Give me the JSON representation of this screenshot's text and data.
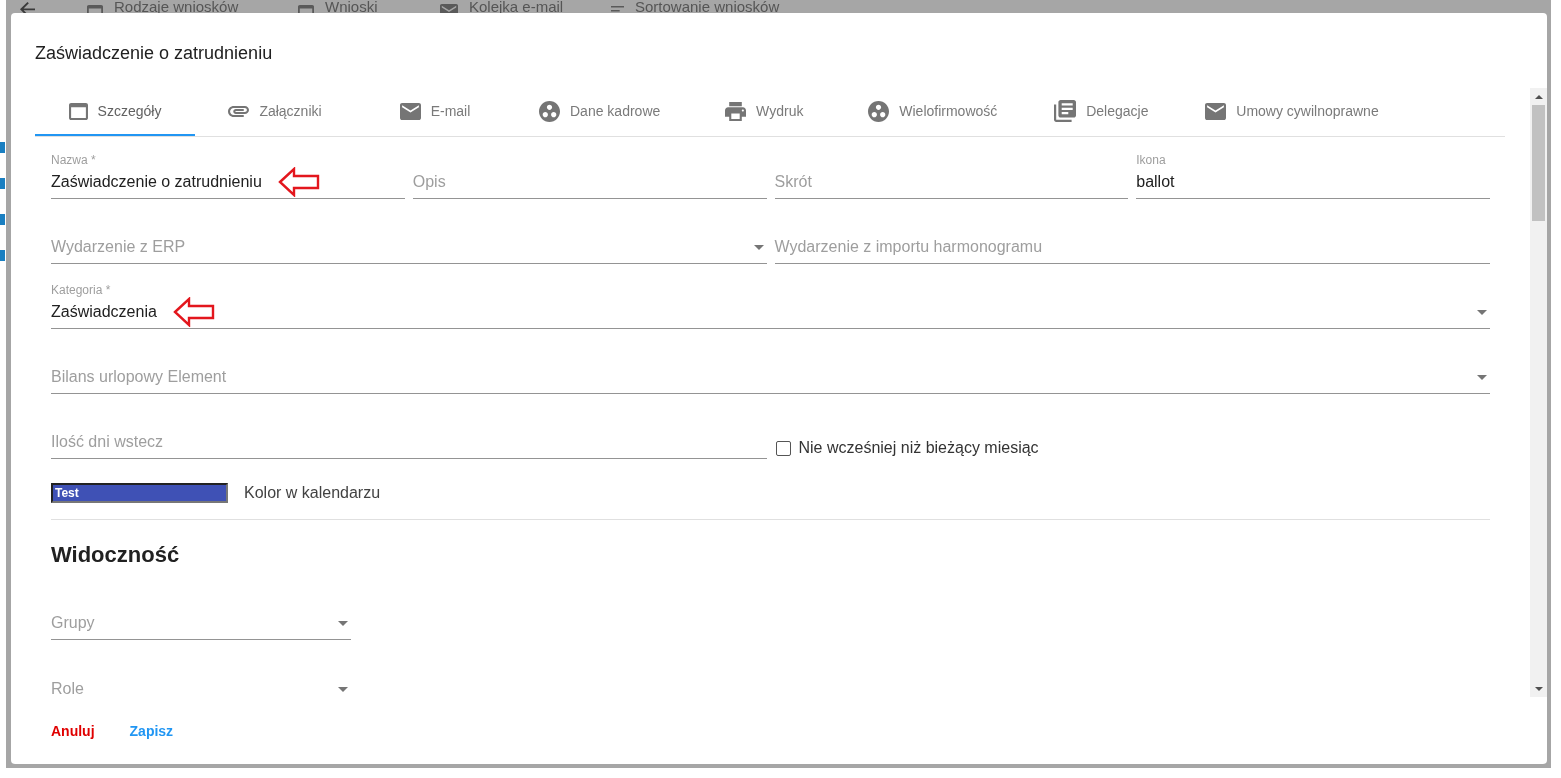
{
  "background_toolbar": [
    {
      "label": "Rodzaje wniosków"
    },
    {
      "label": "Wnioski"
    },
    {
      "label": "Kolejka e-mail"
    },
    {
      "label": "Sortowanie wniosków"
    }
  ],
  "dialog": {
    "title": "Zaświadczenie o zatrudnieniu",
    "tabs": [
      {
        "label": "Szczegóły",
        "selected": true
      },
      {
        "label": "Załączniki",
        "selected": false
      },
      {
        "label": "E-mail",
        "selected": false
      },
      {
        "label": "Dane kadrowe",
        "selected": false
      },
      {
        "label": "Wydruk",
        "selected": false
      },
      {
        "label": "Wielofirmowość",
        "selected": false
      },
      {
        "label": "Delegacje",
        "selected": false
      },
      {
        "label": "Umowy cywilnoprawne",
        "selected": false
      }
    ],
    "form_rows": [
      [
        {
          "kind": "text",
          "label": "Nazwa *",
          "value": "Zaświadczenie o zatrudnieniu",
          "annotated": true
        },
        {
          "kind": "text",
          "placeholder": "Opis",
          "annotated": false
        },
        {
          "kind": "text",
          "placeholder": "Skrót",
          "annotated": false
        },
        {
          "kind": "text",
          "label": "Ikona",
          "value": "ballot",
          "annotated": false
        }
      ],
      [
        {
          "kind": "select",
          "placeholder": "Wydarzenie z ERP",
          "annotated": false
        },
        {
          "kind": "text",
          "placeholder": "Wydarzenie z importu harmonogramu",
          "annotated": false
        }
      ],
      [
        {
          "kind": "select",
          "label": "Kategoria *",
          "value": "Zaświadczenia",
          "annotated": true
        }
      ],
      [
        {
          "kind": "select",
          "placeholder": "Bilans urlopowy Element",
          "annotated": false
        }
      ],
      [
        {
          "kind": "text",
          "placeholder": "Ilość dni wstecz",
          "annotated": false
        },
        {
          "kind": "checkbox",
          "label": "Nie wcześniej niż bieżący miesiąc",
          "checked": false
        }
      ]
    ],
    "color_field": {
      "value": "Test",
      "color": "#3f51b5",
      "label": "Kolor w kalendarzu"
    },
    "visibility": {
      "heading": "Widoczność",
      "fields": [
        {
          "kind": "select",
          "placeholder": "Grupy",
          "annotated": false
        },
        {
          "kind": "select",
          "placeholder": "Role",
          "annotated": false
        }
      ]
    },
    "actions": [
      {
        "label": "Anuluj",
        "kind": "cancel"
      },
      {
        "label": "Zapisz",
        "kind": "save"
      }
    ]
  }
}
